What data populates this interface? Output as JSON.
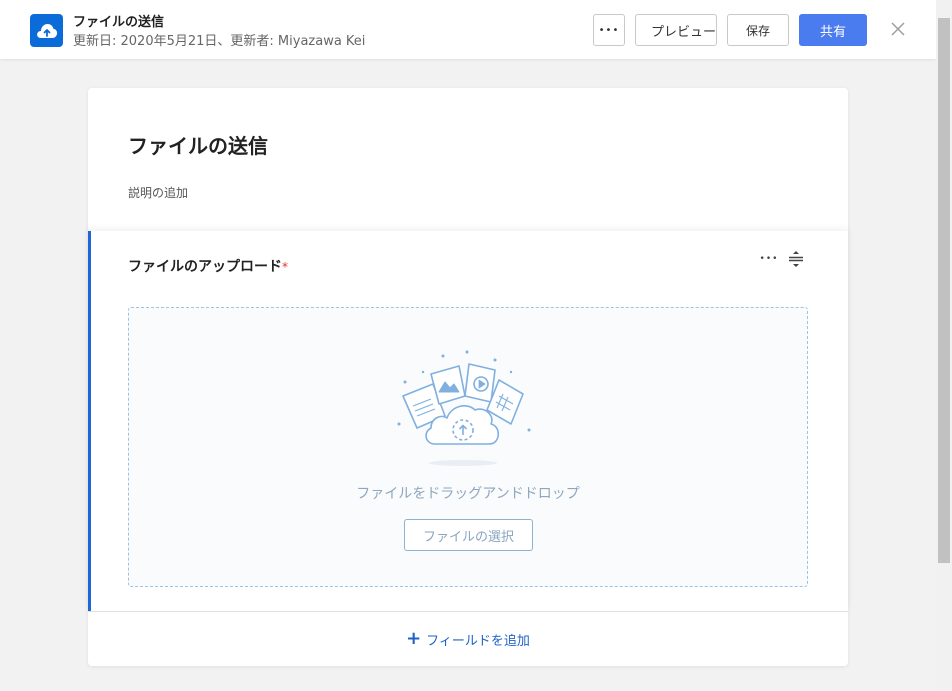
{
  "header": {
    "title": "ファイルの送信",
    "meta": "更新日: 2020年5月21日、更新者: Miyazawa Kei",
    "more_label": "•••",
    "preview_label": "プレビュー",
    "save_label": "保存",
    "share_label": "共有",
    "close_label": "×"
  },
  "form": {
    "title": "ファイルの送信",
    "description": "説明の追加",
    "field": {
      "label": "ファイルのアップロード",
      "required_mark": "*",
      "more_label": "•••",
      "dropzone_text": "ファイルをドラッグアンドドロップ",
      "select_button": "ファイルの選択"
    },
    "add_field_plus": "+",
    "add_field_label": "フィールドを追加"
  },
  "colors": {
    "accent": "#4a7cf0",
    "brand": "#0b6cd9",
    "active_border": "#2166d8",
    "required": "#e0342b",
    "link": "#1f63c6"
  },
  "icons": {
    "app": "cloud-upload-icon",
    "close": "close-icon",
    "drag": "drag-handle-icon",
    "illustration": "files-cloud-upload-illustration"
  }
}
